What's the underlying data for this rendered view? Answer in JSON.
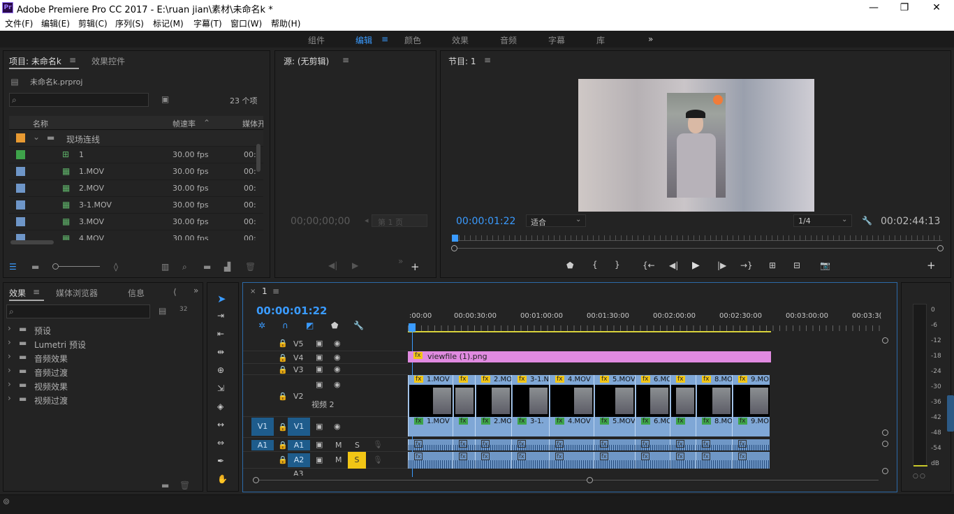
{
  "window": {
    "title": "Adobe Premiere Pro CC 2017 - E:\\ruan jian\\素材\\未命名k *",
    "logo": "Pr",
    "minimize": "—",
    "restore": "❐",
    "close": "✕"
  },
  "menu": [
    "文件(F)",
    "编辑(E)",
    "剪辑(C)",
    "序列(S)",
    "标记(M)",
    "字幕(T)",
    "窗口(W)",
    "帮助(H)"
  ],
  "workspaces": {
    "items": [
      "组件",
      "编辑",
      "颜色",
      "效果",
      "音频",
      "字幕",
      "库"
    ],
    "active": "编辑",
    "more": "»"
  },
  "project": {
    "tab": "项目: 未命名k",
    "tab_effect_controls": "效果控件",
    "file": "未命名k.prproj",
    "count": "23 个项",
    "columns": {
      "name": "名称",
      "fps": "帧速率",
      "media": "媒体开"
    },
    "rows": [
      {
        "name": "现场连线",
        "fps": "",
        "media": "",
        "color": "#e89a32",
        "kind": "bin"
      },
      {
        "name": "1",
        "fps": "30.00 fps",
        "media": "00:",
        "color": "#3ea34a",
        "kind": "sequence"
      },
      {
        "name": "1.MOV",
        "fps": "30.00 fps",
        "media": "00:",
        "color": "#6e96c8",
        "kind": "clip"
      },
      {
        "name": "2.MOV",
        "fps": "30.00 fps",
        "media": "00:",
        "color": "#6e96c8",
        "kind": "clip"
      },
      {
        "name": "3-1.MOV",
        "fps": "30.00 fps",
        "media": "00:",
        "color": "#6e96c8",
        "kind": "clip"
      },
      {
        "name": "3.MOV",
        "fps": "30.00 fps",
        "media": "00:",
        "color": "#6e96c8",
        "kind": "clip"
      },
      {
        "name": "4.MOV",
        "fps": "30.00 fps",
        "media": "00:",
        "color": "#6e96c8",
        "kind": "clip"
      }
    ]
  },
  "source": {
    "tab": "源: (无剪辑)",
    "timecode": "00;00;00;00",
    "page": "第 1 页"
  },
  "program": {
    "tab": "节目: 1",
    "timecode": "00:00:01:22",
    "fit": "适合",
    "quality": "1/4",
    "duration": "00:02:44:13"
  },
  "effects": {
    "tabs": [
      "效果",
      "媒体浏览器",
      "信息",
      "⟨"
    ],
    "tree": [
      "预设",
      "Lumetri 预设",
      "音频效果",
      "音频过渡",
      "视频效果",
      "视频过渡"
    ]
  },
  "timeline": {
    "tab": "1",
    "timecode": "00:00:01:22",
    "ruler": [
      ":00:00",
      "00:00:30:00",
      "00:01:00:00",
      "00:01:30:00",
      "00:02:00:00",
      "00:02:30:00",
      "00:03:00:00",
      "00:03:3("
    ],
    "tracks": {
      "v5": "V5",
      "v4": "V4",
      "v3": "V3",
      "v2": "V2",
      "v2_name": "视频 2",
      "v1": "V1",
      "a1": "A1",
      "a2": "A2",
      "a3": "A3",
      "src_v1": "V1",
      "src_a1": "A1",
      "m": "M",
      "s": "S"
    },
    "v4_clip": "viewfile (1).png",
    "v2_clips": [
      "1.MOV",
      "",
      "2.MO",
      "3-1.N",
      "4.MOV",
      "5.MOV",
      "6.MO",
      "",
      "8.MO",
      "9.MO"
    ],
    "v1_clips": [
      "1.MOV",
      "",
      "2.MO",
      "3-1.",
      "4.MOV",
      "5.MOV",
      "6.MO",
      "",
      "8.MO",
      "9.MO"
    ]
  },
  "meter": {
    "labels": [
      "0",
      "-6",
      "-12",
      "-18",
      "-24",
      "-30",
      "-36",
      "-42",
      "-48",
      "-54",
      "dB"
    ]
  },
  "colors": {
    "accent": "#3a9bff",
    "pink_clip": "#e08ae0",
    "video_clip": "#7fa7d6",
    "solo": "#f2c615",
    "track_blue": "#1e5c8c"
  }
}
